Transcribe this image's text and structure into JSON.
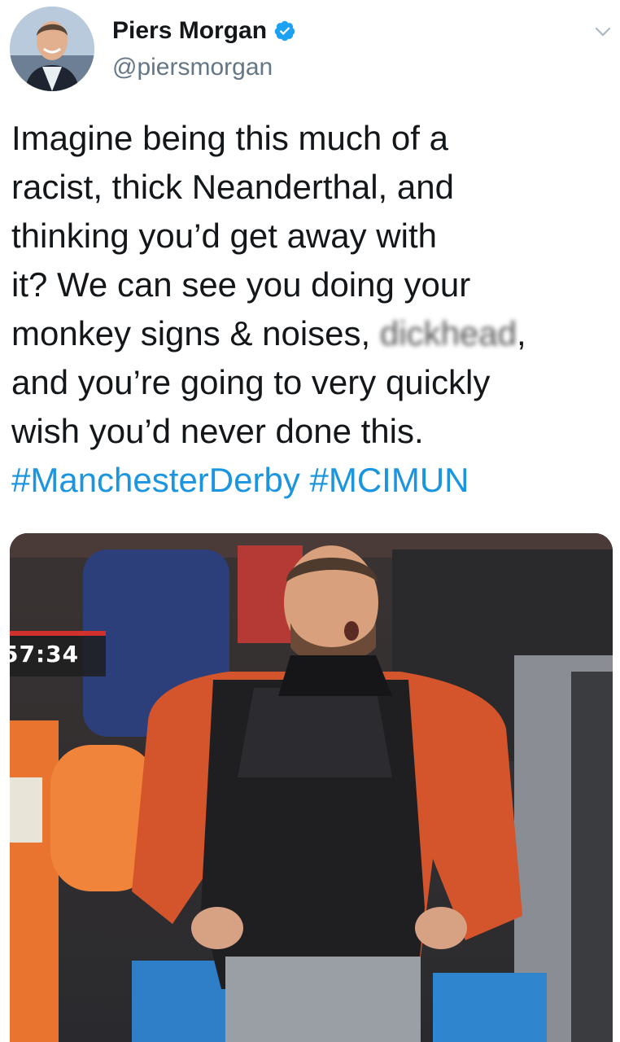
{
  "tweet": {
    "author": {
      "display_name": "Piers Morgan",
      "handle": "@piersmorgan",
      "verified": true,
      "avatar_icon": "avatar-photo"
    },
    "menu_icon": "chevron-down-icon",
    "text_lines": [
      "Imagine being this much of a",
      "racist, thick Neanderthal, and",
      "thinking you’d get away with",
      "it? We can see you doing your"
    ],
    "line5_prefix": "monkey signs & noises, ",
    "line5_blurred": "dickhead",
    "line5_suffix": ",",
    "line6": "and you’re going to very quickly",
    "line7": "wish you’d never done this.",
    "hashtags": [
      "#ManchesterDerby",
      "#MCIMUN"
    ],
    "media": {
      "match_clock": "57:34"
    }
  },
  "colors": {
    "link": "#1b95e0",
    "verified": "#1da1f2",
    "text": "#14171a",
    "secondary": "#657786"
  }
}
